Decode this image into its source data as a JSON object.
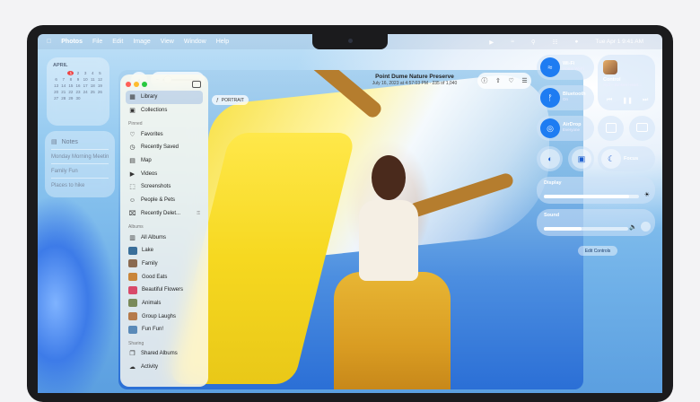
{
  "menubar": {
    "app": "Photos",
    "menus": [
      "File",
      "Edit",
      "Image",
      "View",
      "Window",
      "Help"
    ],
    "datetime": "Tue Apr 1  9:41 AM"
  },
  "calendar_widget": {
    "month": "APRIL",
    "days": [
      "",
      "",
      "1",
      "2",
      "3",
      "4",
      "5",
      "6",
      "7",
      "8",
      "9",
      "10",
      "11",
      "12",
      "13",
      "14",
      "15",
      "16",
      "17",
      "18",
      "19",
      "20",
      "21",
      "22",
      "23",
      "24",
      "25",
      "26",
      "27",
      "28",
      "29",
      "30",
      "",
      ""
    ],
    "today": "1"
  },
  "notes_widget": {
    "title": "Notes",
    "items": [
      "Monday Morning Meeting",
      "Family Fun",
      "Places to hike"
    ]
  },
  "photo": {
    "title": "Point Dume Nature Preserve",
    "subtitle": "July 16, 2023 at 4:57:03 PM  ·  235 of 1,040",
    "badge": "PORTRAIT"
  },
  "sidebar": {
    "top_items": [
      {
        "label": "Library",
        "icon": "library-icon"
      },
      {
        "label": "Collections",
        "icon": "collections-icon"
      }
    ],
    "pinned_header": "Pinned",
    "pinned": [
      {
        "label": "Favorites",
        "icon": "heart-icon"
      },
      {
        "label": "Recently Saved",
        "icon": "clock-icon"
      },
      {
        "label": "Map",
        "icon": "map-icon"
      },
      {
        "label": "Videos",
        "icon": "video-icon"
      },
      {
        "label": "Screenshots",
        "icon": "screenshot-icon"
      },
      {
        "label": "People & Pets",
        "icon": "people-icon"
      },
      {
        "label": "Recently Delet...",
        "icon": "trash-icon"
      }
    ],
    "albums_header": "Albums",
    "albums": [
      {
        "label": "All Albums",
        "icon": "albums-icon"
      },
      {
        "label": "Lake",
        "thumb": "#3a6f9a"
      },
      {
        "label": "Family",
        "thumb": "#8a6a50"
      },
      {
        "label": "Good Eats",
        "thumb": "#c9853a"
      },
      {
        "label": "Beautiful Flowers",
        "thumb": "#d84a6a"
      },
      {
        "label": "Animals",
        "thumb": "#7a8a5a"
      },
      {
        "label": "Group Laughs",
        "thumb": "#b57a4a"
      },
      {
        "label": "Fun Fun!",
        "thumb": "#5a8ab8"
      }
    ],
    "sharing_header": "Sharing",
    "sharing": [
      {
        "label": "Shared Albums",
        "icon": "shared-albums-icon"
      },
      {
        "label": "Activity",
        "icon": "activity-icon"
      }
    ]
  },
  "control_center": {
    "wifi": {
      "label": "Wi-Fi",
      "sub": "Home Wi-Fi"
    },
    "bluetooth": {
      "label": "Bluetooth",
      "sub": "On"
    },
    "airdrop": {
      "label": "AirDrop",
      "sub": "Everyone"
    },
    "now_playing": {
      "label": "Control",
      "sub": "Syd – Broken Heart..."
    },
    "focus": {
      "label": "Focus"
    },
    "display": {
      "label": "Display",
      "level": 0.9
    },
    "sound": {
      "label": "Sound",
      "level": 0.45
    },
    "edit": "Edit Controls"
  },
  "colors": {
    "accent": "#1e7cf2",
    "today": "#e44444"
  }
}
